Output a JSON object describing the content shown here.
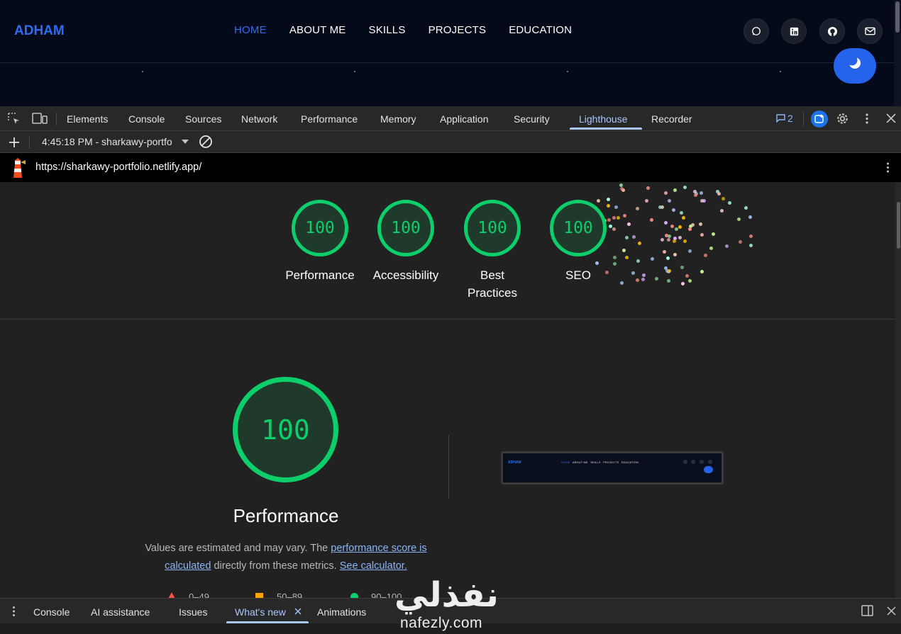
{
  "site": {
    "logo": "ADHAM",
    "nav": [
      "HOME",
      "ABOUT ME",
      "SKILLS",
      "PROJECTS",
      "EDUCATION"
    ],
    "active_nav": "HOME",
    "social_icons": [
      "whatsapp-icon",
      "linkedin-icon",
      "github-icon",
      "mail-icon"
    ],
    "theme_toggle_icon": "moon-icon"
  },
  "devtools": {
    "tabs": [
      "Elements",
      "Console",
      "Sources",
      "Network",
      "Performance",
      "Memory",
      "Application",
      "Security",
      "Lighthouse",
      "Recorder"
    ],
    "active_tab": "Lighthouse",
    "messages_count": "2",
    "report_select": "4:45:18 PM - sharkawy-portfo",
    "url": "https://sharkawy-portfolio.netlify.app/"
  },
  "report": {
    "scores": [
      {
        "value": "100",
        "label": "Performance"
      },
      {
        "value": "100",
        "label": "Accessibility"
      },
      {
        "value": "100",
        "label": "Best Practices"
      },
      {
        "value": "100",
        "label": "SEO"
      }
    ],
    "performance": {
      "score": "100",
      "title": "Performance",
      "desc_prefix": "Values are estimated and may vary. The ",
      "desc_link1": "performance score is calculated",
      "desc_middle": " directly from these metrics. ",
      "desc_link2": "See calculator."
    },
    "legend": [
      "0–49",
      "50–89",
      "90–100"
    ],
    "thumbnail": {
      "logo": "ADHAM",
      "nav": [
        "HOME",
        "ABOUT ME",
        "SKILLS",
        "PROJECTS",
        "EDUCATION"
      ]
    }
  },
  "drawer": {
    "tabs": [
      "Console",
      "AI assistance",
      "Issues",
      "What's new",
      "Animations"
    ],
    "active_tab": "What's new"
  },
  "watermark": {
    "arabic": "نفذلي",
    "latin": "nafezly.com"
  },
  "colors": {
    "accent_blue": "#2d6cf0",
    "score_green": "#0cce6b",
    "devtools_active": "#a8c7fa"
  }
}
